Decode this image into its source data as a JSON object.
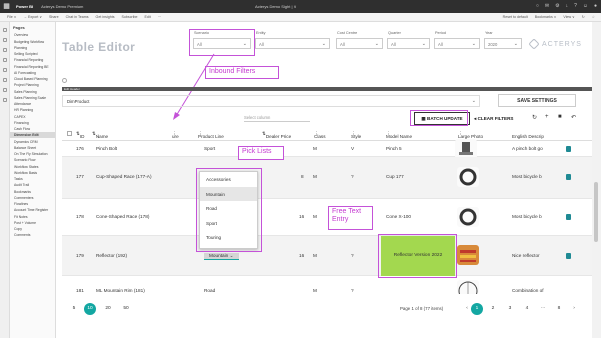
{
  "topbar": {
    "app": "Power BI",
    "file": "Acterys Demo Premium",
    "center": "Acterys Demo Sight | ∨",
    "right": [
      "○",
      "✉",
      "⚙",
      "↓",
      "?",
      "☺",
      "●"
    ]
  },
  "ribbon": {
    "items": [
      "File ∨",
      "→ Export ∨",
      "Share",
      "Chat in Teams",
      "Get insights",
      "Subscribe",
      "Edit",
      "···"
    ],
    "right": [
      "Reset to default",
      "Bookmarks ∨",
      "View ∨",
      "↻",
      "☆"
    ]
  },
  "pages": {
    "header": "Pages",
    "items": [
      "Overview",
      "Budgeting Workflow",
      "Planning",
      "Selling Scripted",
      "Financial Reporting",
      "Financial Reporting BE",
      "AI Forecasting",
      "Cloud Based Planning",
      "Project Planning",
      "Sales Planning",
      "Sales Planning Scale",
      "Attendance",
      "HR Planning",
      "CAPEX",
      "Financing",
      "Cash Flow",
      "Dimension Edit",
      "Dynamics CRM",
      "Balance Sheet",
      "On The Fly Simulation",
      "Scenario Flow",
      "Workflow States",
      "Workflow Basis",
      "Tasks",
      "Audit Trail",
      "Bookmarks",
      "Commenters",
      "Flowlines",
      "Account Time Register",
      "Fit Notes",
      "Post + Volume",
      "Copy",
      "Comments"
    ],
    "selected": 16
  },
  "editor": {
    "title": "Table Editor",
    "brand": "ACTERYS"
  },
  "filters": [
    {
      "label": "Scenario",
      "value": "All"
    },
    {
      "label": "Entity",
      "value": "All"
    },
    {
      "label": "Cost Centre",
      "value": "All"
    },
    {
      "label": "Quarter",
      "value": "All"
    },
    {
      "label": "Period",
      "value": "All"
    },
    {
      "label": "Year",
      "value": "2020"
    }
  ],
  "filterbar_label": "Edit Header",
  "table_selector": "DimProduct",
  "save_label": "SAVE SETTINGS",
  "search_placeholder": "Select column",
  "batch_label": "BATCH UPDATE",
  "clear_label": "CLEAR FILTERS",
  "tools": [
    "↻",
    "+",
    "■",
    "↶"
  ],
  "columns": [
    "ID",
    "Name",
    "ure",
    "Product Line",
    "Dealer Price",
    "Class",
    "Style",
    "Model Name",
    "Large Photo",
    "English Descrip"
  ],
  "rows": [
    {
      "id": "176",
      "name": "Pinch Bolt",
      "product_line": "Sport",
      "dealer_price": "",
      "class": "M",
      "style": "V",
      "model": "Pinch 5",
      "desc": "A pinch bolt go",
      "photo": "bolt"
    },
    {
      "id": "177",
      "name": "Cup-Shaped Race (177-A)",
      "product_line": "",
      "dealer_price": "8",
      "class": "M",
      "style": "?",
      "model": "Cup 177",
      "desc": "Most bicycle b",
      "photo": "ring"
    },
    {
      "id": "178",
      "name": "Cone-Shaped Race (178)",
      "product_line": "",
      "dealer_price": "16",
      "class": "M",
      "style": "?",
      "model": "Cone X-100",
      "desc": "Most bicycle b",
      "photo": "ring"
    },
    {
      "id": "179",
      "name": "Reflector (192)",
      "product_line": "Mountain",
      "dealer_price": "16",
      "class": "M",
      "style": "?",
      "model": "Reflector Version 2022",
      "desc": "Nice reflector",
      "photo": "reflector"
    },
    {
      "id": "181",
      "name": "ML Mountain Rim (181)",
      "product_line": "Road",
      "dealer_price": "",
      "class": "M",
      "style": "?",
      "model": "",
      "desc": "Combination of",
      "photo": "rim"
    }
  ],
  "dropdown_options": [
    "Accessories",
    "Mountain",
    "Road",
    "Sport",
    "Touring"
  ],
  "dropdown_selected": "Mountain",
  "annotations": {
    "inbound_filters": "Inbound Filters",
    "pick_lists": "Pick Lists",
    "free_text": "Free Text\nEntry"
  },
  "pager": {
    "sizes": [
      "5",
      "10",
      "20",
      "50"
    ],
    "selected_size": "10",
    "info": "Page 1 of 8 (77 items)",
    "pages": [
      "1",
      "2",
      "3",
      "4",
      "···",
      "8"
    ],
    "selected_page": "1"
  },
  "colors": {
    "accent_teal": "#13a7a2",
    "annotation_magenta": "#c452d8",
    "green_cell": "#a3d84f",
    "trash": "#1f8a94"
  }
}
